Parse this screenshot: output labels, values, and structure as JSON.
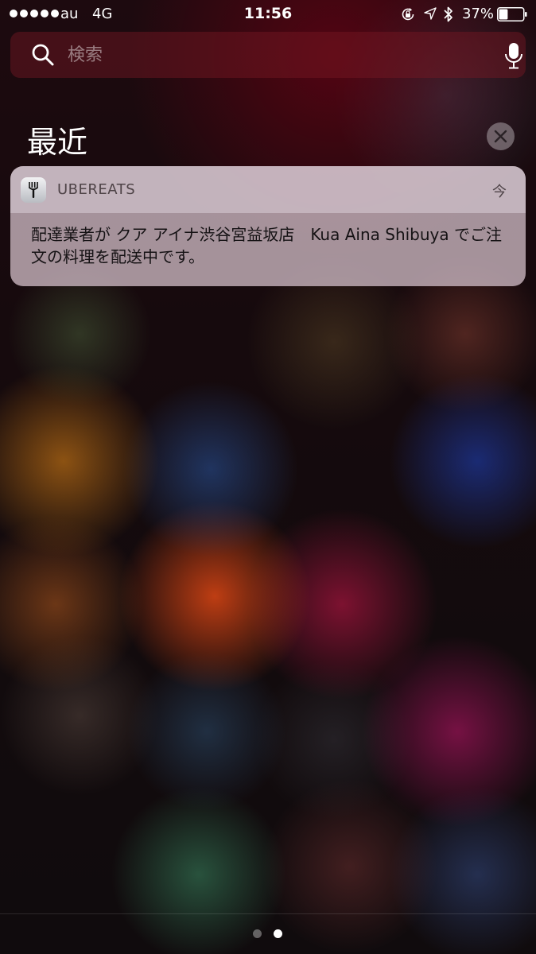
{
  "status_bar": {
    "carrier": "au",
    "network": "4G",
    "time": "11:56",
    "battery_percent": "37%",
    "battery_level": 0.37,
    "signal_bars": 5
  },
  "search": {
    "placeholder": "検索",
    "value": ""
  },
  "recent": {
    "title": "最近"
  },
  "notification": {
    "app_name": "UBEREATS",
    "time": "今",
    "message": "配達業者が クア アイナ渋谷宮益坂店　Kua Aina Shibuya でご注文の料理を配送中です。"
  },
  "pages": {
    "count": 2,
    "current": 2
  },
  "colors": {
    "card_background": "#cdb9c3",
    "header_text": "#4e4347",
    "body_text": "#151214"
  },
  "icons": {
    "search": "search-icon",
    "mic": "mic-icon",
    "clear": "close-icon",
    "app": "fork-icon",
    "rotation_lock": "rotation-lock-icon",
    "location": "location-arrow-icon",
    "bluetooth": "bluetooth-icon",
    "battery": "battery-icon"
  }
}
